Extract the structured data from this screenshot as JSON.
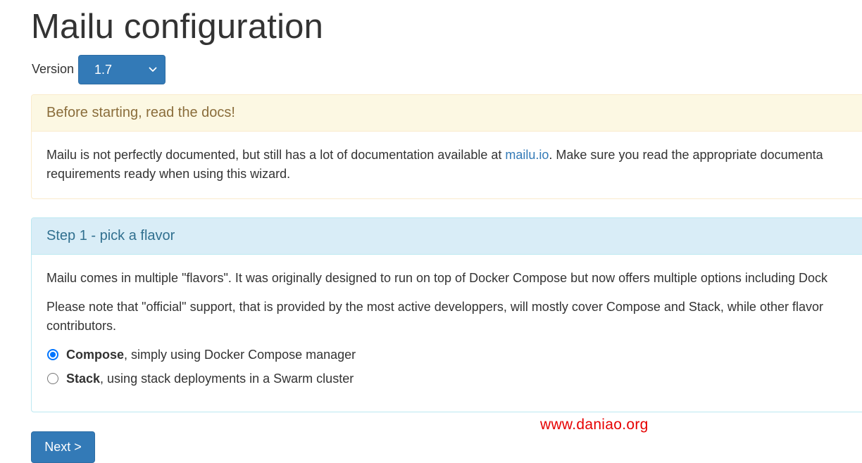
{
  "page": {
    "title": "Mailu configuration"
  },
  "version": {
    "label": "Version",
    "selected": "1.7"
  },
  "docs_panel": {
    "heading": "Before starting, read the docs!",
    "body_before_link": "Mailu is not perfectly documented, but still has a lot of documentation available at ",
    "link_text": "mailu.io",
    "body_after_link": ". Make sure you read the appropriate documenta",
    "body_line2": "requirements ready when using this wizard."
  },
  "step1_panel": {
    "heading": "Step 1 - pick a flavor",
    "para1": "Mailu comes in multiple \"flavors\". It was originally designed to run on top of Docker Compose but now offers multiple options including Dock",
    "para2_line1": "Please note that \"official\" support, that is provided by the most active developpers, will mostly cover Compose and Stack, while other flavor",
    "para2_line2": "contributors.",
    "options": [
      {
        "name": "Compose",
        "description": ", simply using Docker Compose manager",
        "checked": true
      },
      {
        "name": "Stack",
        "description": ", using stack deployments in a Swarm cluster",
        "checked": false
      }
    ]
  },
  "next_button": {
    "label": "Next >"
  },
  "watermark": {
    "text": "www.daniao.org"
  },
  "colors": {
    "primary": "#337ab7",
    "warning_bg": "#fcf8e3",
    "warning_text": "#8a6d3b",
    "info_bg": "#d9edf7",
    "info_text": "#31708f",
    "radio_checked": "#0075ff",
    "watermark": "#e60000"
  },
  "icons": {
    "select_arrow": "chevron-down-icon"
  }
}
